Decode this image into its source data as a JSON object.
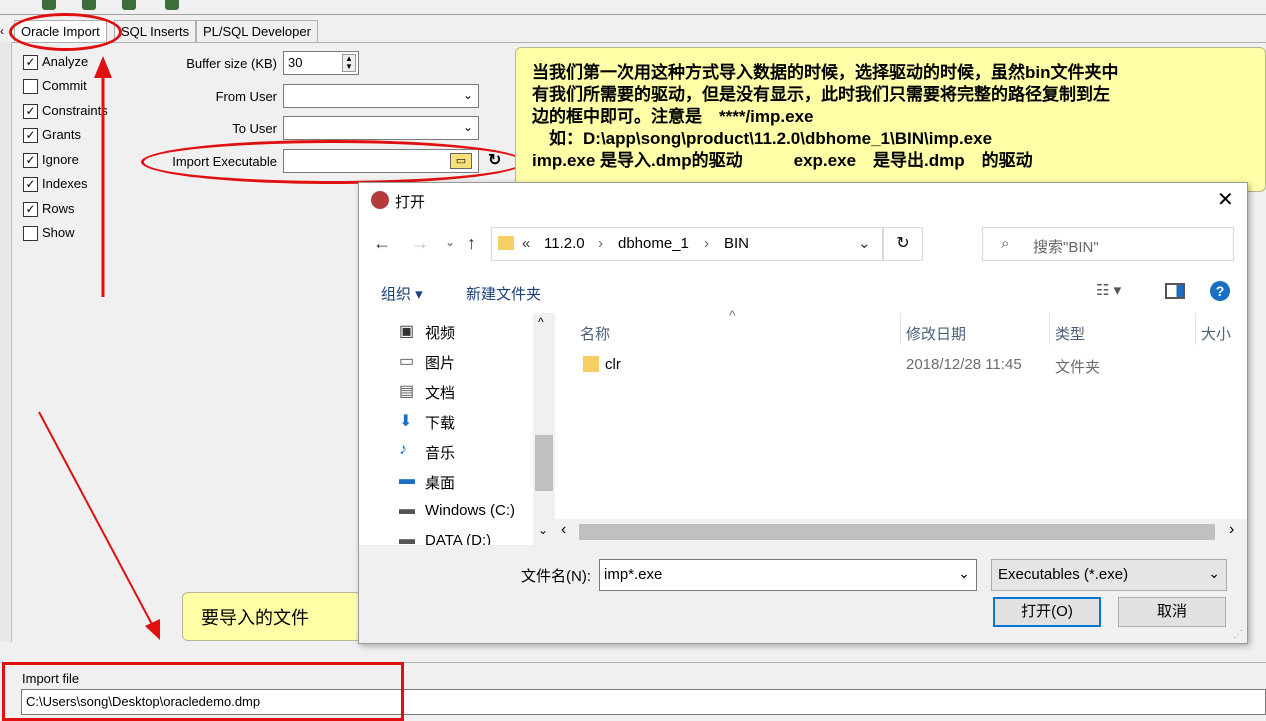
{
  "tabs": [
    {
      "label": "Oracle Import",
      "active": true
    },
    {
      "label": "SQL Inserts",
      "active": false
    },
    {
      "label": "PL/SQL Developer",
      "active": false
    }
  ],
  "options": [
    {
      "label": "Analyze",
      "checked": true
    },
    {
      "label": "Commit",
      "checked": false
    },
    {
      "label": "Constraints",
      "checked": true
    },
    {
      "label": "Grants",
      "checked": true
    },
    {
      "label": "Ignore",
      "checked": true
    },
    {
      "label": "Indexes",
      "checked": true
    },
    {
      "label": "Rows",
      "checked": true
    },
    {
      "label": "Show",
      "checked": false
    }
  ],
  "fields": {
    "buffer_size_label": "Buffer size (KB)",
    "buffer_size_value": "30",
    "from_user_label": "From User",
    "to_user_label": "To User",
    "import_exe_label": "Import Executable"
  },
  "callout": {
    "line1": "当我们第一次用这种方式导入数据的时候，选择驱动的时候，虽然bin文件夹中",
    "line2": "有我们所需要的驱动，但是没有显示，此时我们只需要将完整的路径复制到左",
    "line3": "边的框中即可。注意是　****/imp.exe",
    "line4": "　如：D:\\app\\song\\product\\11.2.0\\dbhome_1\\BIN\\imp.exe",
    "line5": "imp.exe 是导入.dmp的驱动　　　exp.exe　是导出.dmp　的驱动"
  },
  "callout2": "要导入的文件",
  "import_file": {
    "label": "Import file",
    "value": "C:\\Users\\song\\Desktop\\oracledemo.dmp"
  },
  "dialog": {
    "title": "打开",
    "breadcrumb": [
      "«",
      "11.2.0",
      "dbhome_1",
      "BIN"
    ],
    "search_placeholder": "搜索\"BIN\"",
    "organize": "组织 ▾",
    "new_folder": "新建文件夹",
    "nav_items": [
      "视频",
      "图片",
      "文档",
      "下载",
      "音乐",
      "桌面",
      "Windows (C:)",
      "DATA (D:)"
    ],
    "columns": [
      "名称",
      "修改日期",
      "类型",
      "大小"
    ],
    "files": [
      {
        "name": "clr",
        "date": "2018/12/28 11:45",
        "type": "文件夹"
      }
    ],
    "filename_label": "文件名(N):",
    "filename_value": "imp*.exe",
    "filetype_value": "Executables (*.exe)",
    "open_button": "打开(O)",
    "cancel_button": "取消"
  }
}
